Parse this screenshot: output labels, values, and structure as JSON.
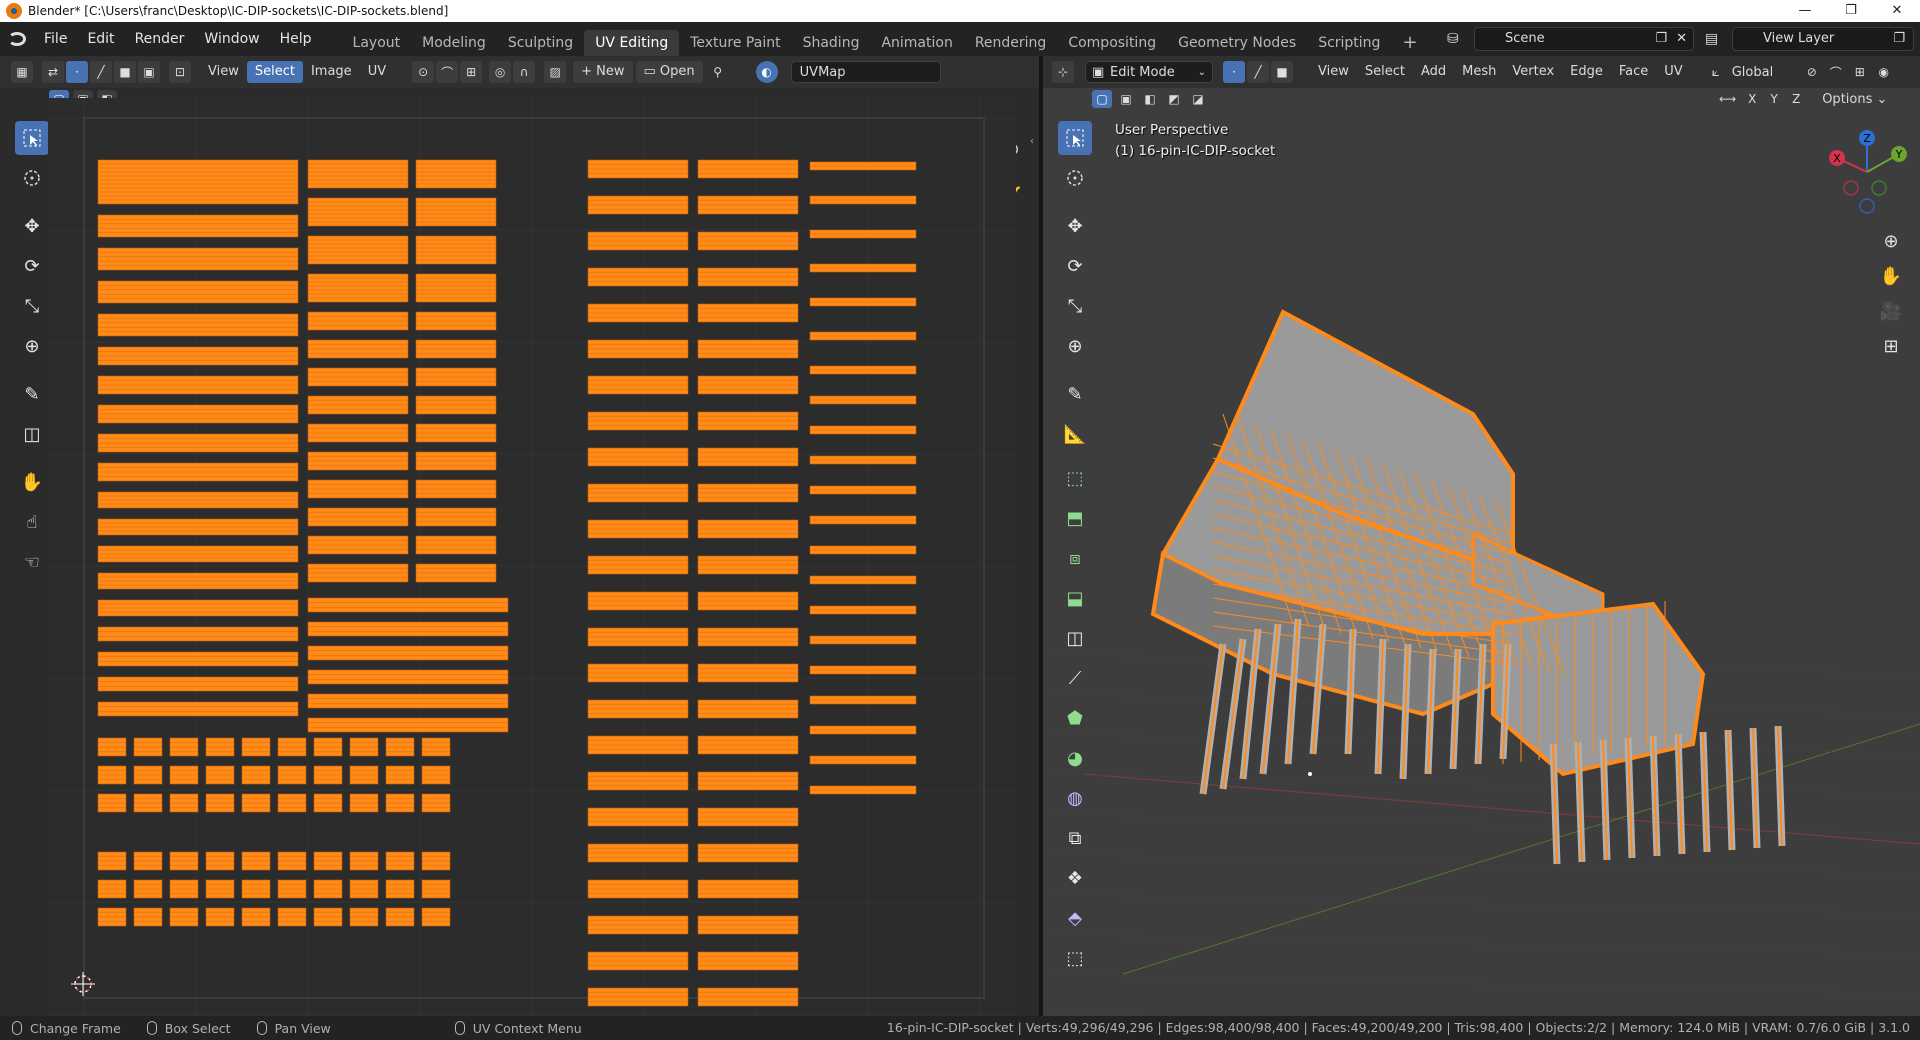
{
  "window": {
    "title": "Blender* [C:\\Users\\franc\\Desktop\\IC-DIP-sockets\\IC-DIP-sockets.blend]",
    "controls": [
      "—",
      "❐",
      "✕"
    ]
  },
  "menu": [
    "File",
    "Edit",
    "Render",
    "Window",
    "Help"
  ],
  "workspaces": [
    "Layout",
    "Modeling",
    "Sculpting",
    "UV Editing",
    "Texture Paint",
    "Shading",
    "Animation",
    "Rendering",
    "Compositing",
    "Geometry Nodes",
    "Scripting"
  ],
  "active_workspace": "UV Editing",
  "scene_field": "Scene",
  "view_layer_field": "View Layer",
  "uv_editor": {
    "header": {
      "view": "View",
      "select": "Select",
      "image": "Image",
      "uv": "UV",
      "new": "New",
      "open": "Open",
      "uvmap": "UVMap"
    },
    "island_color": "#ff8a1a",
    "uv_blocks_major_cols": 3
  },
  "viewport": {
    "header": {
      "mode": "Edit Mode",
      "view": "View",
      "select": "Select",
      "add": "Add",
      "mesh": "Mesh",
      "vertex": "Vertex",
      "edge": "Edge",
      "face": "Face",
      "uv": "UV",
      "orientation": "Global",
      "options": "Options"
    },
    "axes_labels": [
      "X",
      "Y",
      "Z"
    ],
    "overlay_perspective": "User Perspective",
    "overlay_object": "(1) 16-pin-IC-DIP-socket",
    "gizmo": {
      "x": "X",
      "y": "Y",
      "z": "Z"
    },
    "mesh_color": "#ff8a1a",
    "face_color": "#9a9a9a"
  },
  "status": {
    "left": [
      {
        "label": "Change Frame"
      },
      {
        "label": "Box Select"
      },
      {
        "label": "Pan View"
      },
      {
        "label": "UV Context Menu"
      }
    ],
    "right": "16-pin-IC-DIP-socket | Verts:49,296/49,296 | Edges:98,400/98,400 | Faces:49,200/49,200 | Tris:98,400 | Objects:2/2 | Memory: 124.0 MiB | VRAM: 0.7/6.0 GiB | 3.1.0"
  }
}
